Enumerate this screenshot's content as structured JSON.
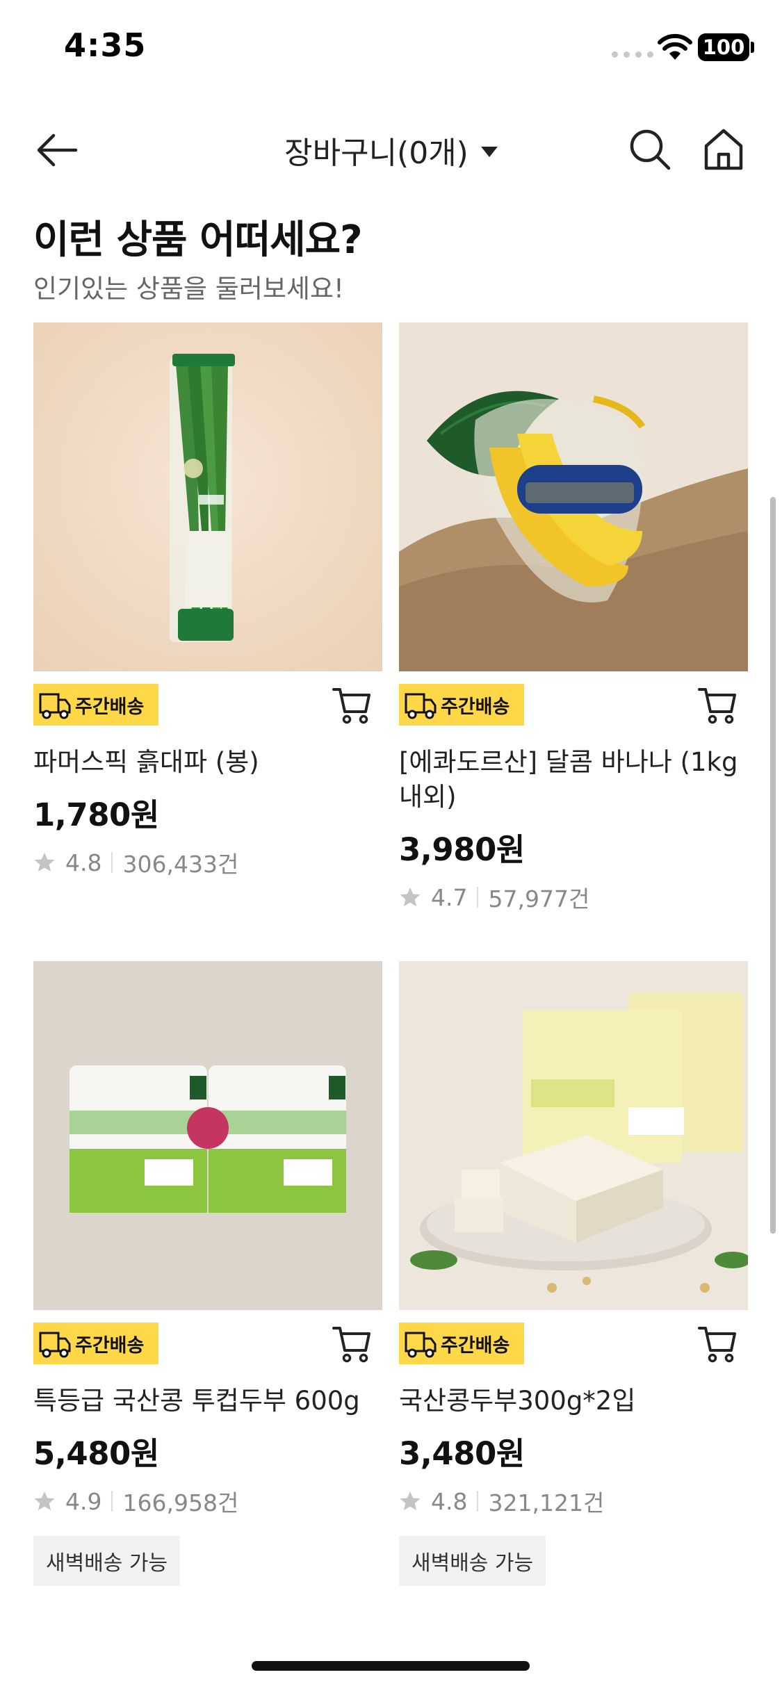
{
  "status_bar": {
    "time": "4:35",
    "battery": "100"
  },
  "nav": {
    "title": "장바구니(0개)"
  },
  "section": {
    "title": "이런 상품 어떠세요?",
    "subtitle": "인기있는 상품을 둘러보세요!"
  },
  "colors": {
    "badge_bg": "#ffd84a",
    "tag_bg": "#f2f2f2",
    "rating_text": "#888888"
  },
  "products": [
    {
      "badge": "주간배송",
      "name": "파머스픽 흙대파 (봉)",
      "price": "1,780원",
      "rating": "4.8",
      "reviews": "306,433건",
      "tag": ""
    },
    {
      "badge": "주간배송",
      "name": "[에콰도르산] 달콤 바나나 (1kg내외)",
      "price": "3,980원",
      "rating": "4.7",
      "reviews": "57,977건",
      "tag": ""
    },
    {
      "badge": "주간배송",
      "name": "특등급 국산콩 투컵두부 600g",
      "price": "5,480원",
      "rating": "4.9",
      "reviews": "166,958건",
      "tag": "새벽배송 가능"
    },
    {
      "badge": "주간배송",
      "name": "국산콩두부300g*2입",
      "price": "3,480원",
      "rating": "4.8",
      "reviews": "321,121건",
      "tag": "새벽배송 가능"
    }
  ]
}
